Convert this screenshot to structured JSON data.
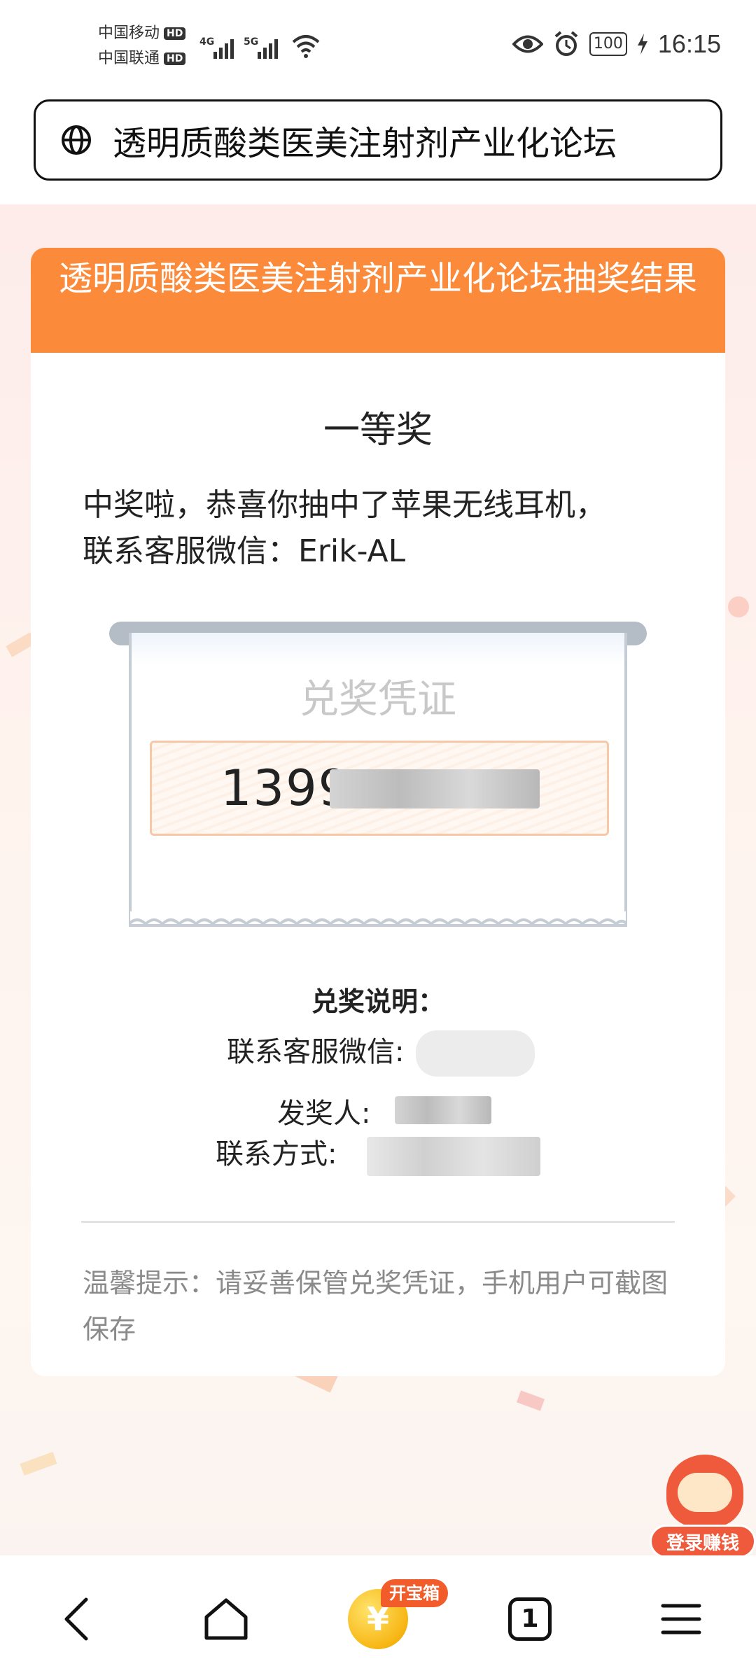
{
  "status_bar": {
    "carrier_1": "中国移动",
    "carrier_2": "中国联通",
    "hd_badge": "HD",
    "network_1": "4G",
    "network_2": "5G",
    "battery": "100",
    "time": "16:15"
  },
  "browser": {
    "address_text": "透明质酸类医美注射剂产业化论坛"
  },
  "card": {
    "header_title": "透明质酸类医美注射剂产业化论坛抽奖结果",
    "prize_level": "一等奖",
    "message_line1": "中奖啦，恭喜你抽中了苹果无线耳机，",
    "message_line2": "联系客服微信：Erik-AL",
    "ticket_title": "兑奖凭证",
    "code_visible": "1399",
    "redeem_title": "兑奖说明：",
    "wechat_label": "联系客服微信:",
    "issuer_label": "发奖人:",
    "contact_label": "联系方式:",
    "tip": "温馨提示：请妥善保管兑奖凭证，手机用户可截图保存"
  },
  "floating_badge": {
    "label": "登录赚钱"
  },
  "bottom_nav": {
    "treasure_tag": "开宝箱",
    "coin_symbol": "¥",
    "tab_count": "1"
  },
  "colors": {
    "accent_orange": "#fb8a3a",
    "badge_red": "#f05a3c",
    "coin_gold": "#f7b614"
  }
}
